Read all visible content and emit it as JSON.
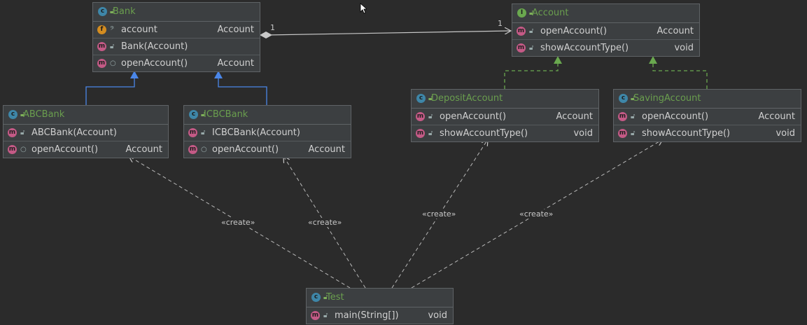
{
  "colors": {
    "background": "#2b2b2b",
    "node_fill": "#3c3f41",
    "class_name": "#6a9e4e",
    "edge_dashed": "#b9b9b9",
    "inherit_extends": "#4a86e8",
    "inherit_implements": "#6aa84f"
  },
  "classes": {
    "bank": {
      "name": "Bank",
      "kind_icon": "class-icon",
      "members": [
        {
          "icon": "field-icon",
          "name": "account",
          "type": "Account"
        },
        {
          "icon": "method-icon",
          "name": "Bank(Account)",
          "type": ""
        },
        {
          "icon": "method-icon",
          "name": "openAccount()",
          "type": "Account"
        }
      ]
    },
    "account": {
      "name": "Account",
      "kind_icon": "interface-icon",
      "members": [
        {
          "icon": "method-icon",
          "name": "openAccount()",
          "type": "Account"
        },
        {
          "icon": "method-icon",
          "name": "showAccountType()",
          "type": "void"
        }
      ]
    },
    "abc_bank": {
      "name": "ABCBank",
      "kind_icon": "class-icon",
      "members": [
        {
          "icon": "method-icon",
          "name": "ABCBank(Account)",
          "type": ""
        },
        {
          "icon": "method-icon",
          "name": "openAccount()",
          "type": "Account"
        }
      ]
    },
    "icbc_bank": {
      "name": "ICBCBank",
      "kind_icon": "class-icon",
      "members": [
        {
          "icon": "method-icon",
          "name": "ICBCBank(Account)",
          "type": ""
        },
        {
          "icon": "method-icon",
          "name": "openAccount()",
          "type": "Account"
        }
      ]
    },
    "deposit_account": {
      "name": "DepositAccount",
      "kind_icon": "class-icon",
      "members": [
        {
          "icon": "method-icon",
          "name": "openAccount()",
          "type": "Account"
        },
        {
          "icon": "method-icon",
          "name": "showAccountType()",
          "type": "void"
        }
      ]
    },
    "saving_account": {
      "name": "SavingAccount",
      "kind_icon": "class-icon",
      "members": [
        {
          "icon": "method-icon",
          "name": "openAccount()",
          "type": "Account"
        },
        {
          "icon": "method-icon",
          "name": "showAccountType()",
          "type": "void"
        }
      ]
    },
    "test": {
      "name": "Test",
      "kind_icon": "class-icon",
      "members": [
        {
          "icon": "method-icon",
          "name": "main(String[])",
          "type": "void"
        }
      ]
    }
  },
  "relations": {
    "association": {
      "from": "Bank",
      "to": "Account",
      "source_multiplicity": "1",
      "target_multiplicity": "1"
    },
    "create_label": "«create»"
  }
}
